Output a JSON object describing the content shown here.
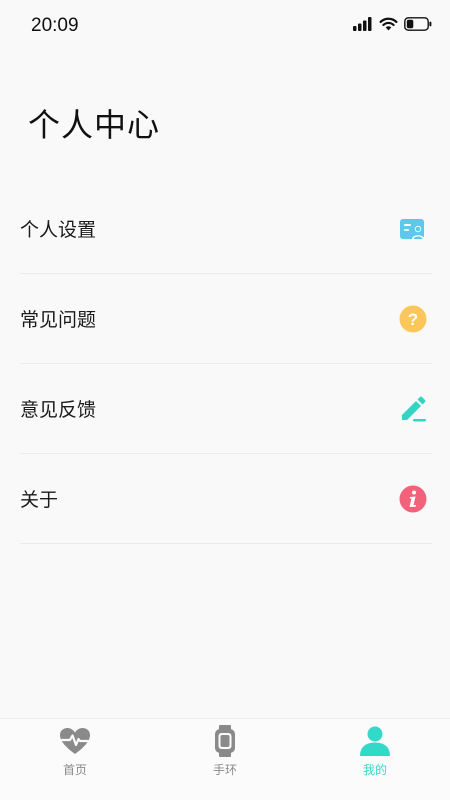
{
  "status_bar": {
    "time": "20:09"
  },
  "page": {
    "title": "个人中心"
  },
  "menu": {
    "items": [
      {
        "label": "个人设置",
        "icon": "profile-card-icon",
        "color": "#5bc8ec"
      },
      {
        "label": "常见问题",
        "icon": "question-icon",
        "color": "#fbc65a"
      },
      {
        "label": "意见反馈",
        "icon": "pencil-icon",
        "color": "#33d4c4"
      },
      {
        "label": "关于",
        "icon": "info-icon",
        "color": "#f2637b"
      }
    ]
  },
  "tab_bar": {
    "tabs": [
      {
        "label": "首页",
        "icon": "heart-pulse-icon",
        "active": false
      },
      {
        "label": "手环",
        "icon": "watch-icon",
        "active": false
      },
      {
        "label": "我的",
        "icon": "user-icon",
        "active": true
      }
    ],
    "active_color": "#33d9c8",
    "inactive_color": "#8a8a8a"
  }
}
